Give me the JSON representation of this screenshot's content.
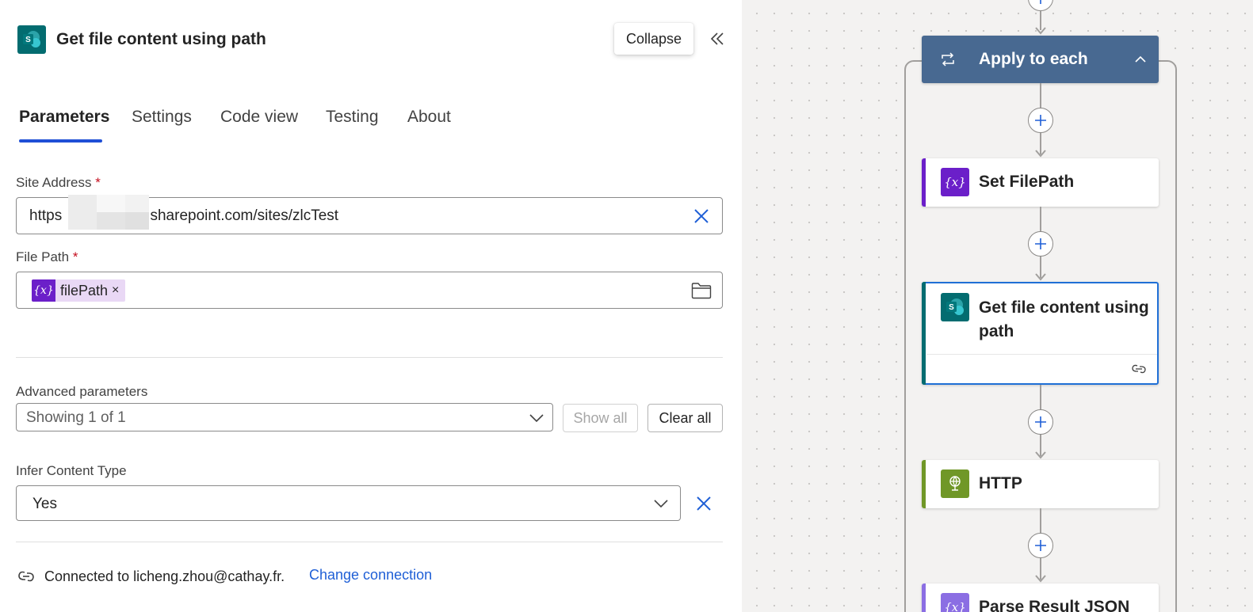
{
  "panel": {
    "title": "Get file content using path",
    "collapse_tooltip": "Collapse",
    "tabs": [
      {
        "label": "Parameters",
        "active": true
      },
      {
        "label": "Settings",
        "active": false
      },
      {
        "label": "Code view",
        "active": false
      },
      {
        "label": "Testing",
        "active": false
      },
      {
        "label": "About",
        "active": false
      }
    ],
    "site_address": {
      "label": "Site Address",
      "required_mark": "*",
      "value_prefix": "https",
      "value_suffix": ".sharepoint.com/sites/zlcTest"
    },
    "file_path": {
      "label": "File Path",
      "required_mark": "*",
      "token_icon": "{x}",
      "token_label": "filePath",
      "token_remove": "×"
    },
    "advanced": {
      "label": "Advanced parameters",
      "selected": "Showing 1 of 1",
      "show_all": "Show all",
      "clear_all": "Clear all"
    },
    "infer_content_type": {
      "label": "Infer Content Type",
      "value": "Yes"
    },
    "connection": {
      "text": "Connected to licheng.zhou@cathay.fr.",
      "change_link": "Change connection"
    }
  },
  "canvas": {
    "loop": {
      "title": "Apply to each",
      "color": "#486991"
    },
    "actions": [
      {
        "title": "Set FilePath",
        "icon": "{x}",
        "color": "#6b1fc9"
      },
      {
        "title": "Get file content using path",
        "icon": "sharepoint-icon",
        "color": "#036c70",
        "selected": true
      },
      {
        "title": "HTTP",
        "icon": "http-globe-icon",
        "color": "#709727"
      },
      {
        "title": "Parse Result JSON",
        "icon": "{x}",
        "color": "#8b6ee3"
      }
    ]
  },
  "colors": {
    "accent": "#1f4fd6",
    "link": "#1f5fd6",
    "required": "#c50f1f"
  }
}
